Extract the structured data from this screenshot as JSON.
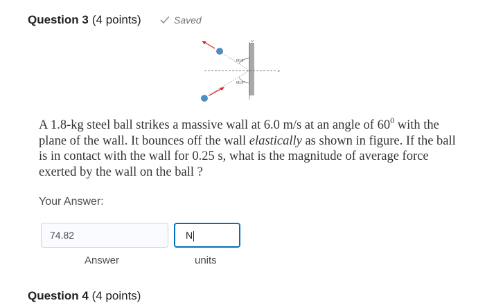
{
  "question": {
    "title": "Question 3",
    "points": "(4 points)",
    "saved": "Saved",
    "text_parts": {
      "p1": "A 1.8-kg steel ball strikes a massive wall at 6.0 m/s at an angle of 60",
      "sup": "0",
      "p2": " with the plane of the wall. It bounces off the wall ",
      "em": "elastically",
      "p3": " as shown in figure. If the ball is in contact with the wall for 0.25 s, what is the magnitude of average force exerted by the wall on the ball ?"
    },
    "figure": {
      "axis_y": "y",
      "axis_x": "x",
      "angle_top": "60.0°",
      "angle_bottom": "60.0°"
    }
  },
  "answer": {
    "prompt": "Your Answer:",
    "value": "74.82",
    "units_value": "N",
    "value_label": "Answer",
    "units_label": "units"
  },
  "next_question": {
    "title": "Question 4",
    "points": "(4 points)"
  },
  "colors": {
    "accent": "#006fbf",
    "ball": "#4a90c8",
    "arrow": "#e02020"
  }
}
